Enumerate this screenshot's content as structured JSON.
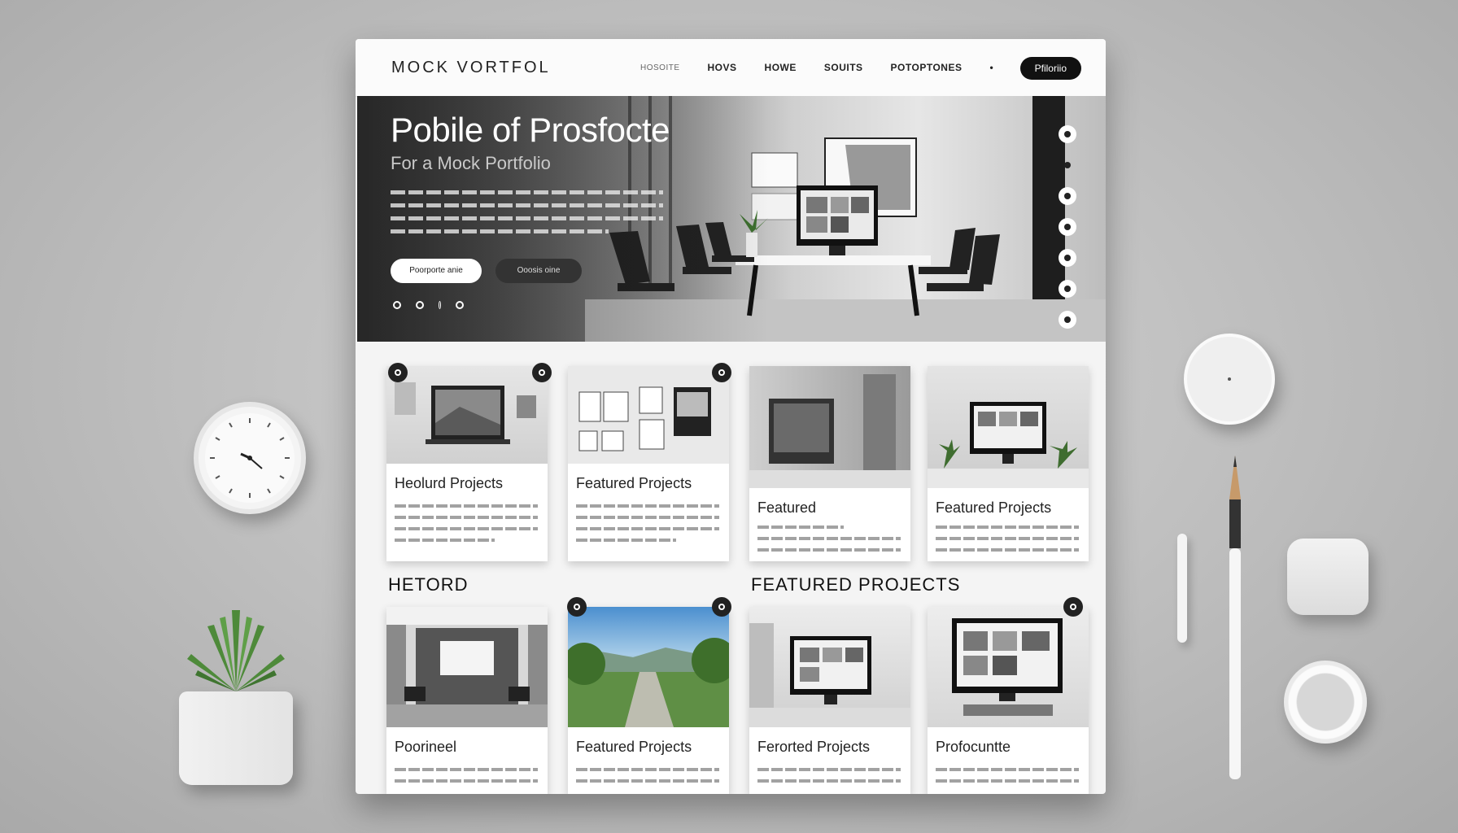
{
  "nav": {
    "logo": "MOCK  VORTFOL",
    "links": [
      "HOSOITE",
      "HOVS",
      "HOWE",
      "SOUITS",
      "POTOPTONES",
      "•"
    ],
    "cta_label": "Pfiloriio"
  },
  "hero": {
    "title": "Pobile of Prosfocte",
    "subtitle": "For a Mock Portfolio",
    "primary_button": "Poorporte anie",
    "secondary_button": "Ooosis oine",
    "carousel_dots": 4,
    "side_dots": 7
  },
  "sections": {
    "left_label": "HETORD",
    "right_label": "FEATURED PROJECTS"
  },
  "cards_row1": [
    {
      "title": "Heolurd Projects"
    },
    {
      "title": "Featured Projects"
    },
    {
      "title": "Featured"
    },
    {
      "title": "Featured Projects"
    }
  ],
  "cards_row2": [
    {
      "title": "Poorineel"
    },
    {
      "title": "Featured Projects"
    },
    {
      "title": "Ferorted Projects"
    },
    {
      "title": "Profocuntte"
    }
  ],
  "colors": {
    "background": "#bdbdbd",
    "accent": "#111111",
    "card": "#ffffff"
  }
}
